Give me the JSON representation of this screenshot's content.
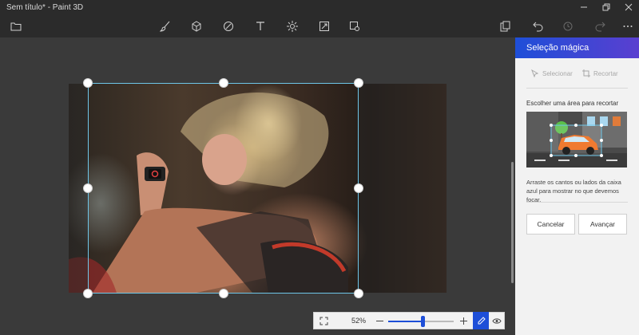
{
  "window": {
    "title": "Sem título* - Paint 3D"
  },
  "toolbar": {
    "icons": [
      "folder-icon",
      "brush-icon",
      "cube-icon",
      "sticker-icon",
      "text-icon",
      "effects-icon",
      "canvas-icon",
      "library-icon",
      "paste-icon",
      "undo-icon",
      "history-icon",
      "redo-icon",
      "more-icon"
    ]
  },
  "panel": {
    "title": "Seleção mágica",
    "select_label": "Selecionar",
    "crop_label": "Recortar",
    "choose_label": "Escolher uma área para recortar",
    "hint": "Arraste os cantos ou lados da caixa azul para mostrar no que devemos focar.",
    "cancel_label": "Cancelar",
    "advance_label": "Avançar"
  },
  "zoom": {
    "percent": "52%",
    "level": 0.52
  },
  "colors": {
    "accent": "#1e4fd8",
    "selection": "#6ec6e8"
  }
}
